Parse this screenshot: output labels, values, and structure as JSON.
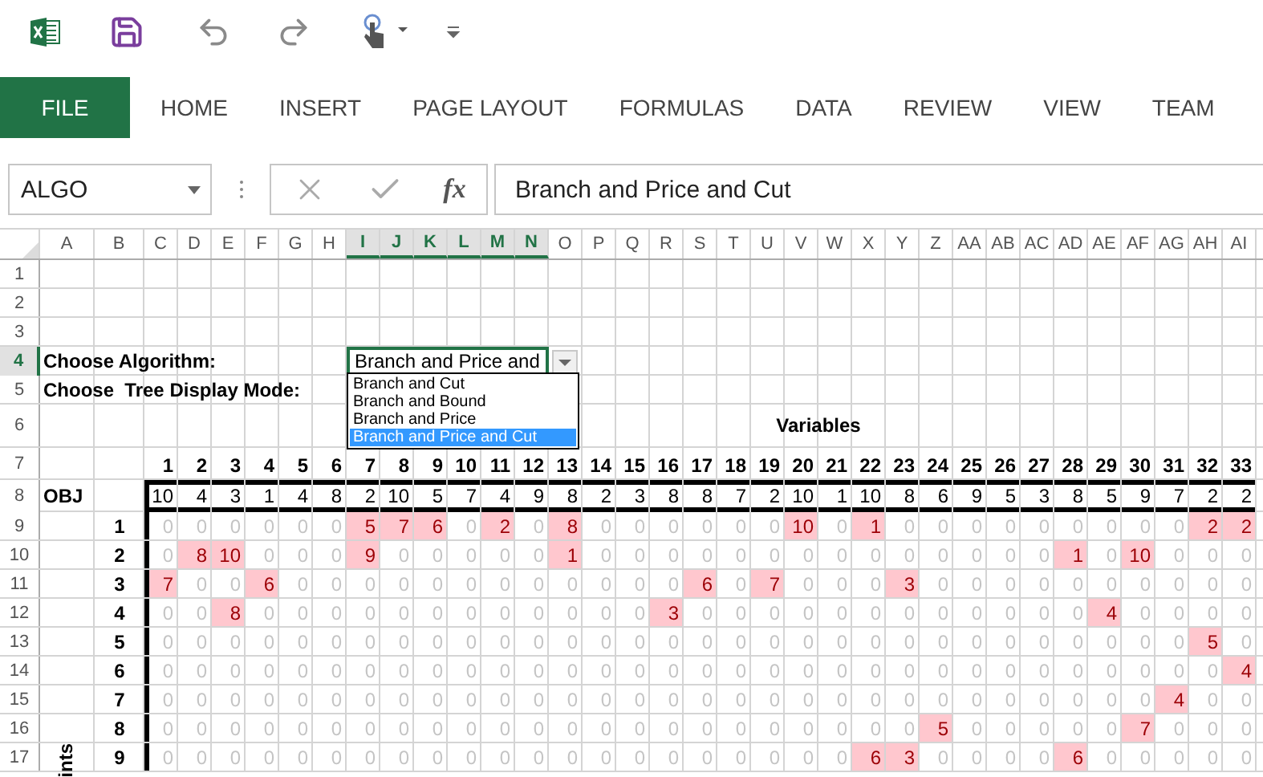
{
  "ribbon_tabs": [
    {
      "label": "FILE",
      "kind": "file"
    },
    {
      "label": "HOME",
      "kind": "tab"
    },
    {
      "label": "INSERT",
      "kind": "tab"
    },
    {
      "label": "PAGE LAYOUT",
      "kind": "tab"
    },
    {
      "label": "FORMULAS",
      "kind": "tab"
    },
    {
      "label": "DATA",
      "kind": "tab"
    },
    {
      "label": "REVIEW",
      "kind": "tab"
    },
    {
      "label": "VIEW",
      "kind": "tab"
    },
    {
      "label": "TEAM",
      "kind": "tab"
    }
  ],
  "name_box": {
    "value": "ALGO"
  },
  "formula_bar": {
    "function_label": "fx",
    "value": "Branch and Price and Cut"
  },
  "sheet": {
    "columns": [
      {
        "label": "A",
        "selected": false
      },
      {
        "label": "B",
        "selected": false
      },
      {
        "label": "C",
        "selected": false
      },
      {
        "label": "D",
        "selected": false
      },
      {
        "label": "E",
        "selected": false
      },
      {
        "label": "F",
        "selected": false
      },
      {
        "label": "G",
        "selected": false
      },
      {
        "label": "H",
        "selected": false
      },
      {
        "label": "I",
        "selected": true
      },
      {
        "label": "J",
        "selected": true
      },
      {
        "label": "K",
        "selected": true
      },
      {
        "label": "L",
        "selected": true
      },
      {
        "label": "M",
        "selected": true
      },
      {
        "label": "N",
        "selected": true
      },
      {
        "label": "O",
        "selected": false
      },
      {
        "label": "P",
        "selected": false
      },
      {
        "label": "Q",
        "selected": false
      },
      {
        "label": "R",
        "selected": false
      },
      {
        "label": "S",
        "selected": false
      },
      {
        "label": "T",
        "selected": false
      },
      {
        "label": "U",
        "selected": false
      },
      {
        "label": "V",
        "selected": false
      },
      {
        "label": "W",
        "selected": false
      },
      {
        "label": "X",
        "selected": false
      },
      {
        "label": "Y",
        "selected": false
      },
      {
        "label": "Z",
        "selected": false
      },
      {
        "label": "AA",
        "selected": false
      },
      {
        "label": "AB",
        "selected": false
      },
      {
        "label": "AC",
        "selected": false
      },
      {
        "label": "AD",
        "selected": false
      },
      {
        "label": "AE",
        "selected": false
      },
      {
        "label": "AF",
        "selected": false
      },
      {
        "label": "AG",
        "selected": false
      },
      {
        "label": "AH",
        "selected": false
      },
      {
        "label": "AI",
        "selected": false
      }
    ],
    "rows": [
      {
        "label": "1",
        "selected": false
      },
      {
        "label": "2",
        "selected": false
      },
      {
        "label": "3",
        "selected": false
      },
      {
        "label": "4",
        "selected": true
      },
      {
        "label": "5",
        "selected": false
      },
      {
        "label": "6",
        "selected": false
      },
      {
        "label": "7",
        "selected": false
      },
      {
        "label": "8",
        "selected": false
      },
      {
        "label": "9",
        "selected": false
      },
      {
        "label": "10",
        "selected": false
      },
      {
        "label": "11",
        "selected": false
      },
      {
        "label": "12",
        "selected": false
      },
      {
        "label": "13",
        "selected": false
      },
      {
        "label": "14",
        "selected": false
      },
      {
        "label": "15",
        "selected": false
      },
      {
        "label": "16",
        "selected": false
      },
      {
        "label": "17",
        "selected": false
      }
    ],
    "algorithm_label": "Choose Algorithm:",
    "tree_mode_label": "Choose  Tree Display Mode:",
    "algorithm_select": {
      "value": "Branch and Price and",
      "expanded": true,
      "options": [
        {
          "label": "Branch and Cut",
          "selected": false
        },
        {
          "label": "Branch and Bound",
          "selected": false
        },
        {
          "label": "Branch and Price",
          "selected": false
        },
        {
          "label": "Branch and Price and Cut",
          "selected": true
        }
      ]
    },
    "variables_title": "Variables",
    "variable_numbers": [
      "1",
      "2",
      "3",
      "4",
      "5",
      "6",
      "7",
      "8",
      "9",
      "10",
      "11",
      "12",
      "13",
      "14",
      "15",
      "16",
      "17",
      "18",
      "19",
      "20",
      "21",
      "22",
      "23",
      "24",
      "25",
      "26",
      "27",
      "28",
      "29",
      "30",
      "31",
      "32",
      "33"
    ],
    "obj_label": "OBJ",
    "obj_values": [
      "10",
      "4",
      "3",
      "1",
      "4",
      "8",
      "2",
      "10",
      "5",
      "7",
      "4",
      "9",
      "8",
      "2",
      "3",
      "8",
      "8",
      "7",
      "2",
      "10",
      "1",
      "10",
      "8",
      "6",
      "9",
      "5",
      "3",
      "8",
      "5",
      "9",
      "7",
      "2",
      "2"
    ],
    "constraints": [
      {
        "label": "1",
        "values": [
          "0",
          "0",
          "0",
          "0",
          "0",
          "0",
          "5",
          "7",
          "6",
          "0",
          "2",
          "0",
          "8",
          "0",
          "0",
          "0",
          "0",
          "0",
          "0",
          "10",
          "0",
          "1",
          "0",
          "0",
          "0",
          "0",
          "0",
          "0",
          "0",
          "0",
          "0",
          "2",
          "2"
        ],
        "highlighted": [
          false,
          false,
          false,
          false,
          false,
          false,
          true,
          true,
          true,
          false,
          true,
          false,
          true,
          false,
          false,
          false,
          false,
          false,
          false,
          true,
          false,
          true,
          false,
          false,
          false,
          false,
          false,
          false,
          false,
          false,
          false,
          true,
          true
        ]
      },
      {
        "label": "2",
        "values": [
          "0",
          "8",
          "10",
          "0",
          "0",
          "0",
          "9",
          "0",
          "0",
          "0",
          "0",
          "0",
          "1",
          "0",
          "0",
          "0",
          "0",
          "0",
          "0",
          "0",
          "0",
          "0",
          "0",
          "0",
          "0",
          "0",
          "0",
          "1",
          "0",
          "10",
          "0",
          "0",
          "0"
        ],
        "highlighted": [
          false,
          true,
          true,
          false,
          false,
          false,
          true,
          false,
          false,
          false,
          false,
          false,
          true,
          false,
          false,
          false,
          false,
          false,
          false,
          false,
          false,
          false,
          false,
          false,
          false,
          false,
          false,
          true,
          false,
          true,
          false,
          false,
          false
        ]
      },
      {
        "label": "3",
        "values": [
          "7",
          "0",
          "0",
          "6",
          "0",
          "0",
          "0",
          "0",
          "0",
          "0",
          "0",
          "0",
          "0",
          "0",
          "0",
          "0",
          "6",
          "0",
          "7",
          "0",
          "0",
          "0",
          "3",
          "0",
          "0",
          "0",
          "0",
          "0",
          "0",
          "0",
          "0",
          "0",
          "0"
        ],
        "highlighted": [
          true,
          false,
          false,
          true,
          false,
          false,
          false,
          false,
          false,
          false,
          false,
          false,
          false,
          false,
          false,
          false,
          true,
          false,
          true,
          false,
          false,
          false,
          true,
          false,
          false,
          false,
          false,
          false,
          false,
          false,
          false,
          false,
          false
        ]
      },
      {
        "label": "4",
        "values": [
          "0",
          "0",
          "8",
          "0",
          "0",
          "0",
          "0",
          "0",
          "0",
          "0",
          "0",
          "0",
          "0",
          "0",
          "0",
          "3",
          "0",
          "0",
          "0",
          "0",
          "0",
          "0",
          "0",
          "0",
          "0",
          "0",
          "0",
          "0",
          "4",
          "0",
          "0",
          "0",
          "0"
        ],
        "highlighted": [
          false,
          false,
          true,
          false,
          false,
          false,
          false,
          false,
          false,
          false,
          false,
          false,
          false,
          false,
          false,
          true,
          false,
          false,
          false,
          false,
          false,
          false,
          false,
          false,
          false,
          false,
          false,
          false,
          true,
          false,
          false,
          false,
          false
        ]
      },
      {
        "label": "5",
        "values": [
          "0",
          "0",
          "0",
          "0",
          "0",
          "0",
          "0",
          "0",
          "0",
          "0",
          "0",
          "0",
          "0",
          "0",
          "0",
          "0",
          "0",
          "0",
          "0",
          "0",
          "0",
          "0",
          "0",
          "0",
          "0",
          "0",
          "0",
          "0",
          "0",
          "0",
          "0",
          "5",
          "0"
        ],
        "highlighted": [
          false,
          false,
          false,
          false,
          false,
          false,
          false,
          false,
          false,
          false,
          false,
          false,
          false,
          false,
          false,
          false,
          false,
          false,
          false,
          false,
          false,
          false,
          false,
          false,
          false,
          false,
          false,
          false,
          false,
          false,
          false,
          true,
          false
        ]
      },
      {
        "label": "6",
        "values": [
          "0",
          "0",
          "0",
          "0",
          "0",
          "0",
          "0",
          "0",
          "0",
          "0",
          "0",
          "0",
          "0",
          "0",
          "0",
          "0",
          "0",
          "0",
          "0",
          "0",
          "0",
          "0",
          "0",
          "0",
          "0",
          "0",
          "0",
          "0",
          "0",
          "0",
          "0",
          "0",
          "4"
        ],
        "highlighted": [
          false,
          false,
          false,
          false,
          false,
          false,
          false,
          false,
          false,
          false,
          false,
          false,
          false,
          false,
          false,
          false,
          false,
          false,
          false,
          false,
          false,
          false,
          false,
          false,
          false,
          false,
          false,
          false,
          false,
          false,
          false,
          false,
          true
        ]
      },
      {
        "label": "7",
        "values": [
          "0",
          "0",
          "0",
          "0",
          "0",
          "0",
          "0",
          "0",
          "0",
          "0",
          "0",
          "0",
          "0",
          "0",
          "0",
          "0",
          "0",
          "0",
          "0",
          "0",
          "0",
          "0",
          "0",
          "0",
          "0",
          "0",
          "0",
          "0",
          "0",
          "0",
          "4",
          "0",
          "0"
        ],
        "highlighted": [
          false,
          false,
          false,
          false,
          false,
          false,
          false,
          false,
          false,
          false,
          false,
          false,
          false,
          false,
          false,
          false,
          false,
          false,
          false,
          false,
          false,
          false,
          false,
          false,
          false,
          false,
          false,
          false,
          false,
          false,
          true,
          false,
          false
        ]
      },
      {
        "label": "8",
        "values": [
          "0",
          "0",
          "0",
          "0",
          "0",
          "0",
          "0",
          "0",
          "0",
          "0",
          "0",
          "0",
          "0",
          "0",
          "0",
          "0",
          "0",
          "0",
          "0",
          "0",
          "0",
          "0",
          "0",
          "5",
          "0",
          "0",
          "0",
          "0",
          "0",
          "7",
          "0",
          "0",
          "0"
        ],
        "highlighted": [
          false,
          false,
          false,
          false,
          false,
          false,
          false,
          false,
          false,
          false,
          false,
          false,
          false,
          false,
          false,
          false,
          false,
          false,
          false,
          false,
          false,
          false,
          false,
          true,
          false,
          false,
          false,
          false,
          false,
          true,
          false,
          false,
          false
        ]
      },
      {
        "label": "9",
        "values": [
          "0",
          "0",
          "0",
          "0",
          "0",
          "0",
          "0",
          "0",
          "0",
          "0",
          "0",
          "0",
          "0",
          "0",
          "0",
          "0",
          "0",
          "0",
          "0",
          "0",
          "0",
          "6",
          "3",
          "0",
          "0",
          "0",
          "0",
          "6",
          "0",
          "0",
          "0",
          "0",
          "0"
        ],
        "highlighted": [
          false,
          false,
          false,
          false,
          false,
          false,
          false,
          false,
          false,
          false,
          false,
          false,
          false,
          false,
          false,
          false,
          false,
          false,
          false,
          false,
          false,
          true,
          true,
          false,
          false,
          false,
          false,
          true,
          false,
          false,
          false,
          false,
          false
        ]
      }
    ],
    "side_label": "ints"
  }
}
